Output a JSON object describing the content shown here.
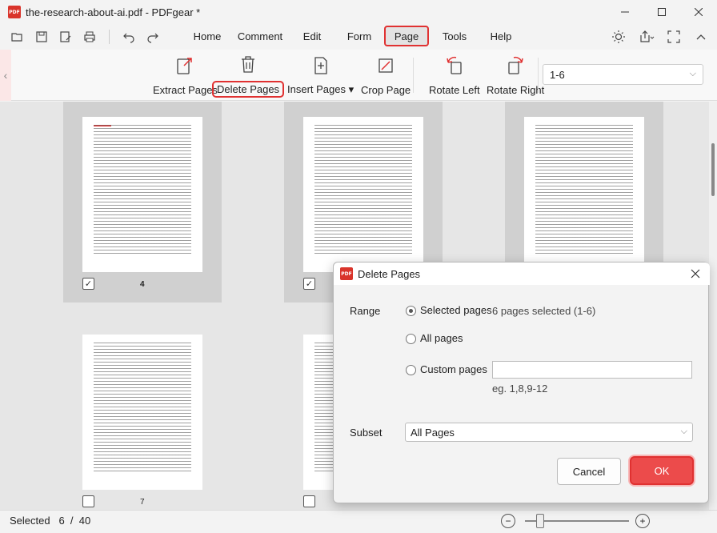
{
  "window": {
    "title": "the-research-about-ai.pdf - PDFgear *",
    "logo_text": "PDF"
  },
  "menu": {
    "tabs": [
      "Home",
      "Comment",
      "Edit",
      "Form",
      "Page",
      "Tools",
      "Help"
    ],
    "active": "Page"
  },
  "ribbon": {
    "extract": "Extract Pages",
    "delete": "Delete Pages",
    "insert": "Insert Pages",
    "crop": "Crop Page",
    "rotate_left": "Rotate Left",
    "rotate_right": "Rotate Right",
    "range_value": "1-6"
  },
  "pages": {
    "p4": "4",
    "p7": "7"
  },
  "status": {
    "label": "Selected",
    "selected": "6",
    "separator": "/",
    "total": "40"
  },
  "dialog": {
    "title": "Delete Pages",
    "range_label": "Range",
    "opt_selected": "Selected pages",
    "selected_info": "6  pages selected (1-6)",
    "opt_all": "All pages",
    "opt_custom": "Custom pages",
    "custom_value": "",
    "example": "eg. 1,8,9-12",
    "subset_label": "Subset",
    "subset_value": "All Pages",
    "cancel": "Cancel",
    "ok": "OK"
  },
  "colors": {
    "accent": "#e03131",
    "ok_bg": "#ec4b4b"
  }
}
